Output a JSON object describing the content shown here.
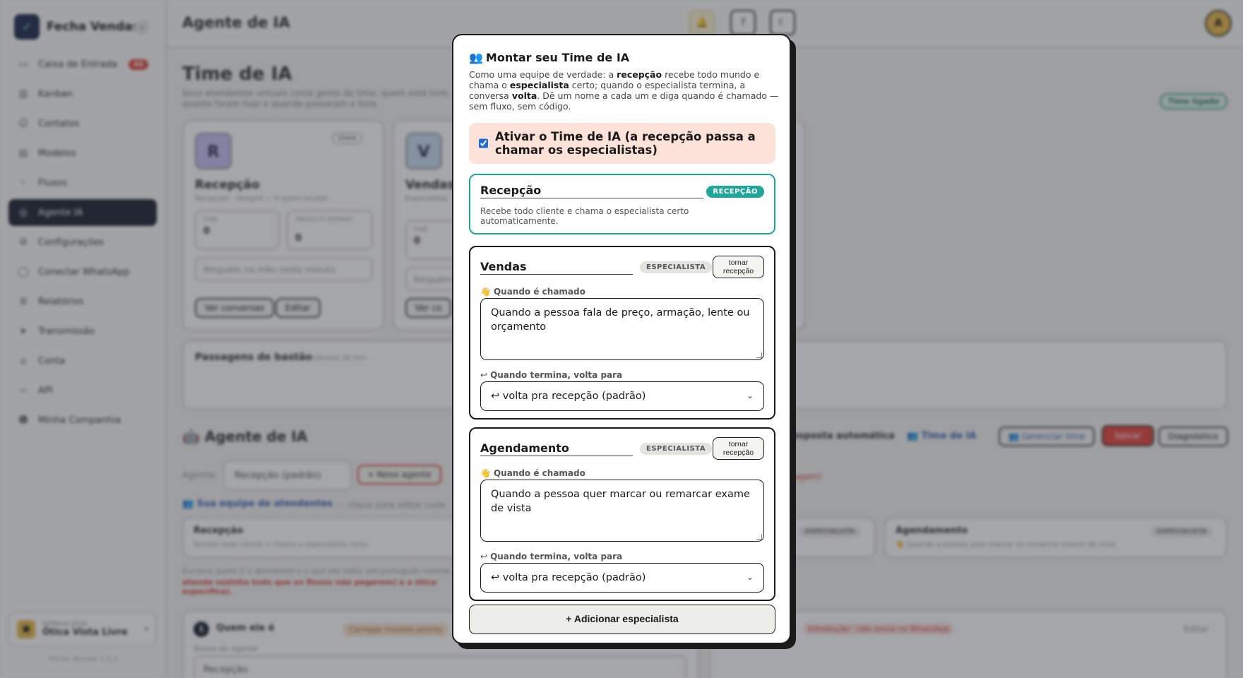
{
  "sidebar": {
    "brand": "Fecha Vendas",
    "collapse_icon": "«",
    "items": [
      {
        "label": "Caixa de Entrada",
        "icon": "inbox-icon",
        "glyph": "▭",
        "badge": "44"
      },
      {
        "label": "Kanban",
        "icon": "kanban-icon",
        "glyph": "▥"
      },
      {
        "label": "Contatos",
        "icon": "contacts-icon",
        "glyph": "☺"
      },
      {
        "label": "Modelos",
        "icon": "templates-icon",
        "glyph": "▤"
      },
      {
        "label": "Fluxos",
        "icon": "flows-icon",
        "glyph": "⑂"
      },
      {
        "label": "Agente IA",
        "icon": "robot-icon",
        "glyph": "◎",
        "active": true
      },
      {
        "label": "Configurações",
        "icon": "gear-icon",
        "glyph": "⚙"
      },
      {
        "label": "Conectar WhatsApp",
        "icon": "whatsapp-icon",
        "glyph": "◯"
      },
      {
        "label": "Relatórios",
        "icon": "reports-icon",
        "glyph": "≣"
      },
      {
        "label": "Transmissão",
        "icon": "send-icon",
        "glyph": "➤"
      },
      {
        "label": "Conta",
        "icon": "account-icon",
        "glyph": "⌂"
      },
      {
        "label": "API",
        "icon": "code-icon",
        "glyph": "‹›"
      },
      {
        "label": "Minha Companhia",
        "icon": "team-icon",
        "glyph": "☻"
      }
    ],
    "company_label": "EMPRESA ATIVA",
    "company_name": "Ótica Vista Livre",
    "version": "Fecha Vendas 1.0.0"
  },
  "topbar": {
    "title": "Agente de IA",
    "avatar_initial": "A"
  },
  "background": {
    "title": "Time de IA",
    "subtitle": "Seus atendentes virtuais como gente do time: quem está livre, quanto foram hoje e quando passaram a bola.",
    "status_badge": "Time ligado",
    "card1": {
      "initial": "R",
      "name": "Recepção",
      "sub": "Recepção · Sempre — é quem recebe",
      "free": "Livre",
      "today_label": "HOJE",
      "today": "0",
      "handoffs_label": "PASSOU P/ HUMANO",
      "handoffs": "0",
      "note": "Ninguém na mão neste minuto",
      "btn1": "Ver conversas",
      "btn2": "Editar"
    },
    "card2": {
      "initial": "V",
      "name": "Vendas",
      "sub": "Especialista",
      "today_label": "HOJE",
      "today": "0",
      "note": "Ninguém",
      "btn1": "Ver co"
    },
    "passes_title": "Passagens de bastão",
    "passes_sub": "últimos 30 min",
    "agent_section": "🤖 Agente de IA",
    "agent_label": "Agente:",
    "agent_select": "Recepção (padrão)",
    "new_agent": "+ Novo agente",
    "auto_reply": "esposta automática",
    "team_toggle": "👥 Time de IA",
    "manage_team": "👥 Gerenciar time",
    "save": "Salvar",
    "diagnostics": "Diagnóstico",
    "team_heading": "👥 Sua equipe de atendentes",
    "team_hint": "— clique para editar cada",
    "red_note": "agem)",
    "mini_recep_name": "Recepção",
    "mini_recep_desc": "Recebe todo cliente e chama o especialista certo",
    "mini_spec_badge": "ESPECIALISTA",
    "mini_ag_name": "Agendamento",
    "mini_ag_desc": "👋 Quando a pessoa quer marcar ou remarcar exame de vista",
    "help_text": "Escreva quem é o atendente e o que ele sabe, em português normal.",
    "help_red": "atende sozinho tudo que os fluxos não pegarem) e a ética específica).",
    "step_num": "1",
    "step_title": "Quem ele é",
    "load_model": "Carregar modelo pronto",
    "intro_red": "Introdução · não envia no WhatsApp",
    "edit": "Editar",
    "name_label": "Nome do agente",
    "name_value": "Recepção"
  },
  "modal": {
    "title": "Montar seu Time de IA",
    "title_icon": "👥",
    "desc_1": "Como uma equipe de verdade: a ",
    "desc_b1": "recepção",
    "desc_2": " recebe todo mundo e chama o ",
    "desc_b2": "especialista",
    "desc_3": " certo; quando o especialista termina, a conversa ",
    "desc_b3": "volta",
    "desc_4": ". Dê um nome a cada um e diga quando é chamado — sem fluxo, sem código.",
    "toggle_label": "Ativar o Time de IA (a recepção passa a chamar os especialistas)",
    "toggle_checked": true,
    "reception": {
      "name": "Recepção",
      "badge": "RECEPÇÃO",
      "desc": "Recebe todo cliente e chama o especialista certo automaticamente."
    },
    "trigger_label": "Quando é chamado",
    "return_label": "Quando termina, volta para",
    "specialist_badge": "ESPECIALISTA",
    "make_reception": "tornar recepção",
    "specialists": [
      {
        "name": "Vendas",
        "trigger": "Quando a pessoa fala de preço, armação, lente ou orçamento",
        "return_to": "↩ volta pra recepção (padrão)"
      },
      {
        "name": "Agendamento",
        "trigger": "Quando a pessoa quer marcar ou remarcar exame de vista",
        "return_to": "↩ volta pra recepção (padrão)"
      }
    ],
    "add_specialist": "+ Adicionar especialista"
  }
}
